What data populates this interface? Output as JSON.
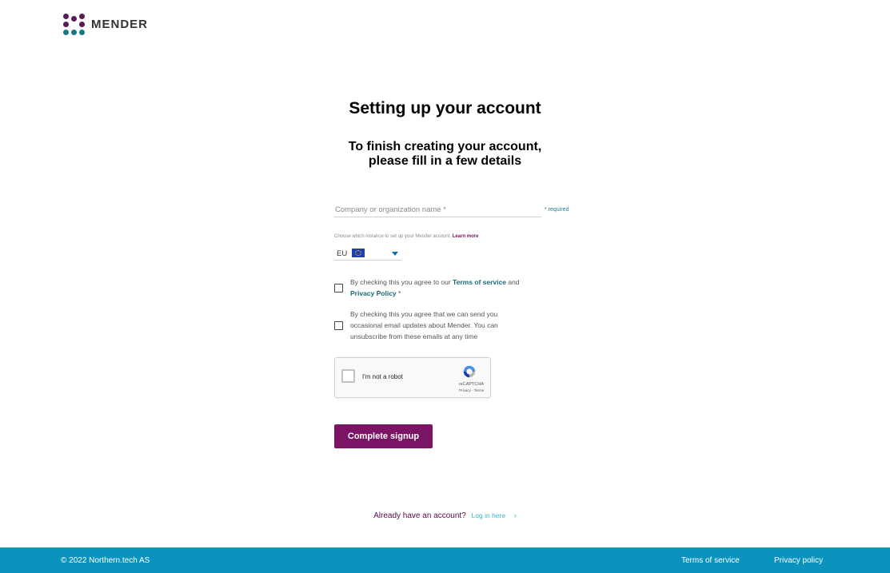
{
  "header": {
    "logo_text": "MENDER",
    "logo_icon": "mender-logo-icon"
  },
  "title": "Setting up your account",
  "subtitle": [
    "To finish creating your account,",
    "please fill in a few details"
  ],
  "form": {
    "company_placeholder": "Company or organization name *",
    "company_value": "",
    "required_note": "* required",
    "instance_help": "Choose which instance to set up your Mender account.",
    "learn_more": "Learn more",
    "instance_value": "EU",
    "instance_flag_icon": "eu-flag-icon"
  },
  "checkboxes": {
    "terms": {
      "prefix": "By checking this you agree to our ",
      "terms_link": "Terms of service",
      "mid": " and",
      "privacy_link": "Privacy Policy",
      "suffix": " *"
    },
    "marketing": [
      "By checking this you agree that we can send you",
      "occasional email updates about Mender. You can",
      "unsubscribe from these emails at any time"
    ]
  },
  "captcha": {
    "label": "I'm not a robot",
    "brand": "reCAPTCHA",
    "links": "Privacy - Terms"
  },
  "submit_label": "Complete signup",
  "login": {
    "question": "Already have an account?",
    "link": "Log in here",
    "chevron": "›"
  },
  "footer": {
    "copyright": "© 2022 Northern.tech AS",
    "terms": "Terms of service",
    "privacy": "Privacy policy"
  },
  "colors": {
    "brand_purple": "#7c1466",
    "brand_teal": "#1a6a7a",
    "footer_blue": "#0a93bd",
    "link_cyan": "#2fb8d8"
  }
}
